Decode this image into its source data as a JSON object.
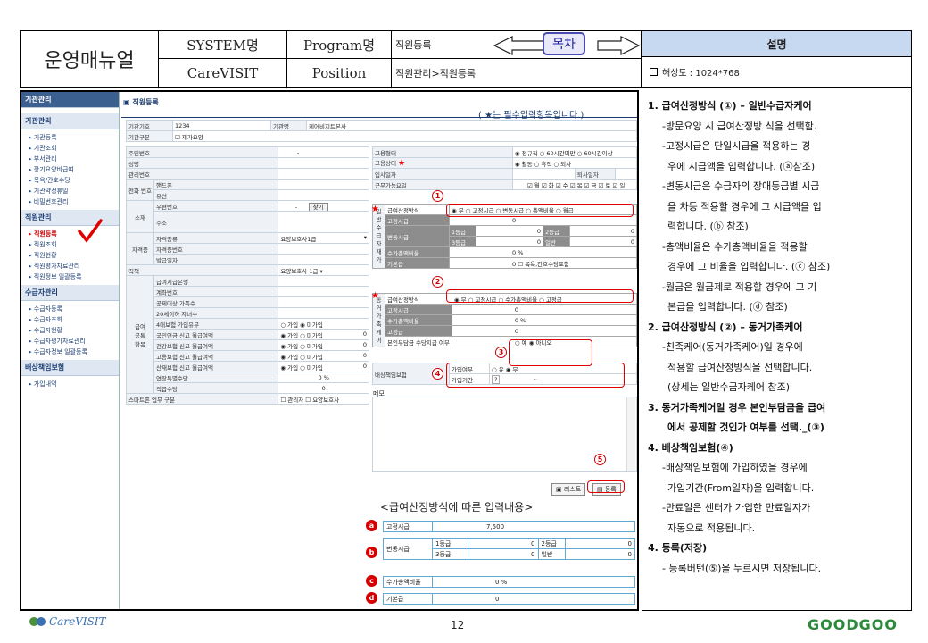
{
  "header": {
    "manual_title": "운영매뉴얼",
    "system_label": "SYSTEM명",
    "program_label": "Program명",
    "program_value": "직원등록",
    "toc_label": "목차",
    "system_value": "CareVISIT",
    "position_label": "Position",
    "position_value": "직원관리>직원등록",
    "desc_title": "설명",
    "resolution": "해상도 : 1024*768"
  },
  "sidebar": {
    "head": "기관관리",
    "sections": [
      {
        "title": "기관관리",
        "items": [
          "기관등록",
          "기관조회",
          "부서관리",
          "장기요양비급여",
          "목욕/간호수당",
          "기관약정휴일",
          "비밀번호관리"
        ]
      },
      {
        "title": "직원관리",
        "items": [
          "직원등록",
          "직원조회",
          "직원현황",
          "직원평가자료관리",
          "직원정보 일괄등록"
        ]
      },
      {
        "title": "수급자관리",
        "items": [
          "수급자등록",
          "수급자조회",
          "수급자현황",
          "수급자평가자료관리",
          "수급자정보 일괄등록"
        ]
      },
      {
        "title": "배상책임보험",
        "items": [
          "가입내역"
        ]
      }
    ]
  },
  "form": {
    "title": "직원등록",
    "required_note": "( ★는 필수입력항목입니다.)",
    "org_code_label": "기관기호",
    "org_code": "1234",
    "org_name_label": "기관명",
    "org_name": "케어비지트본사",
    "org_type_label": "기관구분",
    "org_type": "재가요양",
    "left_labels": [
      "주민번호",
      "성명",
      "관리번호",
      "전화\n번호",
      "핸드폰",
      "유선",
      "소재",
      "우편번호",
      "주소",
      "자격증",
      "자격종류",
      "자격증번호",
      "발급일자",
      "직책",
      "급여\n공통\n항목",
      "급여지급은행",
      "계좌번호",
      "공제대상 가족수",
      "20세이하 자녀수",
      "4대보험 가입유무",
      "국민연금 신고 월급여액",
      "건강보험 신고 월급여액",
      "고용보험 신고 월급여액",
      "산재보험 신고 월급여액",
      "연장특별수당",
      "직급수당",
      "스마트폰 업무 구분"
    ],
    "find_btn": "찾기",
    "qual_value": "요양보호사1급",
    "pos_value": "요양보호사 1급",
    "ins_join": "가입",
    "ins_notjoin": "미가입",
    "zero": "0",
    "pct": "%",
    "ext_pct": "0",
    "grade_pay": "0",
    "smart_mgr": "관리자",
    "smart_care": "요양보호사",
    "emp_type_label": "고용형태",
    "emp_type": "◉ 정규직 ○ 60시간미만 ○ 60시간이상",
    "emp_state_label": "고용상태",
    "emp_state": "◉ 활동 ○ 휴직 ○ 퇴사",
    "hire_label": "입사일자",
    "leave_label": "퇴사일자",
    "workdays_label": "근무가능요일",
    "workdays": "☑ 월 ☑ 화 ☑ 수 ☑ 목 ☑ 금 ☑ 토 ☑ 일",
    "general_label": "일반수급자재가",
    "pay_method_label": "급여산정방식",
    "pay_method": "◉ 무 ○ 고정시급 ○ 변동시급 ○ 총액비율 ○ 월급",
    "fixed_label": "고정시급",
    "var_label": "변동시급",
    "grade1": "1등급",
    "grade2": "2등급",
    "grade3": "3등급",
    "general": "일반",
    "rate_label": "수가총액비율",
    "base_label": "기본급",
    "bath": "목욕,간호수당포함",
    "family_label": "동거가족케어",
    "pay_method2": "◉ 무 ○ 고정시급 ○ 수가총액비율 ○ 고정급",
    "fixed2": "고정급",
    "deduct_label": "본인부담금 수당지급 여부",
    "deduct": "○ 예 ◉ 아니오",
    "liab_label": "배상책임보험",
    "liab_join": "가입여부",
    "liab_opt": "○ 유 ◉ 무",
    "liab_period": "가입기간",
    "memo_label": "메모",
    "list_btn": "리스트",
    "save_btn": "등록"
  },
  "legend": {
    "title": "<급여산정방식에 따른 입력내용>",
    "a_label": "고정시급",
    "a_value": "7,500",
    "b_label": "변동시급",
    "b_g1": "1등급",
    "b_g2": "2등급",
    "b_g3": "3등급",
    "b_gen": "일반",
    "zero": "0",
    "c_label": "수가총액비율",
    "c_value": "0 %",
    "d_label": "기본급",
    "d_value": "0"
  },
  "right": {
    "p1": "1.  급여산정방식 (①) – 일반수급자케어",
    "p1a": "-방문요양 시 급여산정방 식을 선택함.",
    "p1b": "-고정시급은 단일시급을 적용하는 경",
    "p1c": "우에 시급액을 입력합니다. (ⓐ참조)",
    "p1d": "-변동시급은 수급자의 장애등급별 시급",
    "p1e": "을 차등 적용할 경우에 그 시급액을 입",
    "p1f": "력합니다. (ⓑ 참조)",
    "p1g": "-총액비율은 수가총액비율을 적용할",
    "p1h": "경우에 그 비율을 입력합니다. (ⓒ 참조)",
    "p1i": "-월급은 월급제로 적용할 경우에 그 기",
    "p1j": "본급을 입력합니다. (ⓓ 참조)",
    "p2": "2.  급여산정방식 (②) – 동거가족케어",
    "p2a": "-친족케어(동거가족케어)일 경우에",
    "p2b": "적용할 급여산정방식을 선택합니다.",
    "p2c": "(상세는 일반수급자케어 참조)",
    "p3": "3.  동거가족케어일 경우 본인부담금을 급여",
    "p3a": "에서 공제할 것인가 여부를 선택._(③)",
    "p4": "4.  배상책임보험(④)",
    "p4a": "-배상책임보험에 가입하였을 경우에",
    "p4b": "가입기간(From일자)을 입력합니다.",
    "p4c": "-만료일은 센터가 가입한 만료일자가",
    "p4d": "자동으로 적용됩니다.",
    "p5": "4.  등록(저장)",
    "p5a": "- 등록버턴(⑤)을 누르시면 저장됩니다."
  },
  "footer": {
    "page": "12",
    "logo_left": "CareVISIT",
    "logo_right": "GOODGOO"
  }
}
